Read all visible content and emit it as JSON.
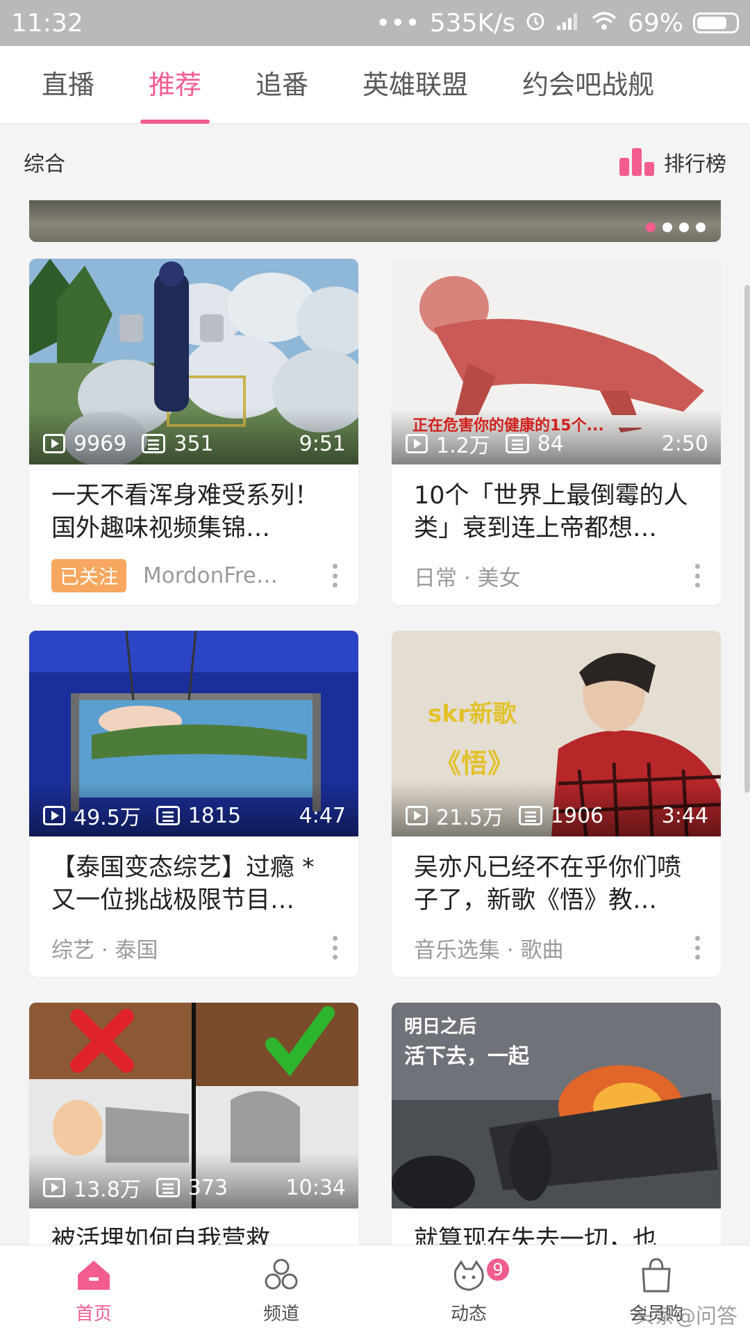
{
  "status_bar": {
    "time": "11:32",
    "dots": "•••",
    "speed": "535K/s",
    "battery_pct": "69%"
  },
  "tabs": [
    {
      "label": "直播",
      "active": false
    },
    {
      "label": "推荐",
      "active": true
    },
    {
      "label": "追番",
      "active": false
    },
    {
      "label": "英雄联盟",
      "active": false
    },
    {
      "label": "约会吧战舰",
      "active": false
    }
  ],
  "subheader": {
    "left": "综合",
    "ranking": "排行榜"
  },
  "banner": {
    "page_count": 4,
    "active_index": 0
  },
  "cards": [
    {
      "views": "9969",
      "danmaku": "351",
      "duration": "9:51",
      "title": "一天不看浑身难受系列！国外趣味视频集锦…",
      "followed_label": "已关注",
      "footer": "MordonFre…"
    },
    {
      "views": "1.2万",
      "danmaku": "84",
      "duration": "2:50",
      "title": "10个「世界上最倒霉的人类」衰到连上帝都想…",
      "footer": "日常 · 美女",
      "thumb_caption": "正在危害你的健康的15个..."
    },
    {
      "views": "49.5万",
      "danmaku": "1815",
      "duration": "4:47",
      "title": "【泰国变态综艺】过瘾 * 又一位挑战极限节目…",
      "footer": "综艺 · 泰国"
    },
    {
      "views": "21.5万",
      "danmaku": "1906",
      "duration": "3:44",
      "title": "吴亦凡已经不在乎你们喷子了，新歌《悟》教…",
      "footer": "音乐选集 · 歌曲",
      "thumb_text_1": "skr新歌",
      "thumb_text_2": "《悟》"
    },
    {
      "views": "13.8万",
      "danmaku": "373",
      "duration": "10:34",
      "title": "被活埋如何自我营救",
      "footer": ""
    },
    {
      "views": "",
      "danmaku": "",
      "duration": "",
      "title": "就算现在失去一切，也",
      "footer": "",
      "thumb_text_1": "明日之后",
      "thumb_text_2": "活下去，一起"
    }
  ],
  "bottom_nav": [
    {
      "label": "首页",
      "icon": "home-icon",
      "active": true
    },
    {
      "label": "频道",
      "icon": "channel-icon",
      "active": false
    },
    {
      "label": "动态",
      "icon": "dynamic-icon",
      "active": false,
      "badge": "9"
    },
    {
      "label": "会员购",
      "icon": "shop-bag-icon",
      "active": false
    }
  ],
  "watermark": "头条@问答",
  "colors": {
    "accent": "#f25d8e",
    "follow_badge": "#f7a75f"
  }
}
